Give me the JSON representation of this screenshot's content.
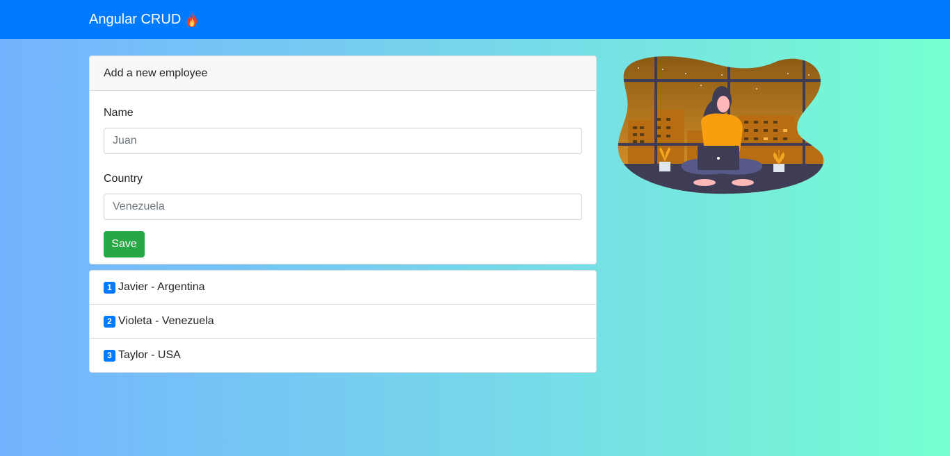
{
  "navbar": {
    "brand": "Angular CRUD",
    "brand_icon": "flame-icon",
    "bg_color": "#007bff"
  },
  "form": {
    "header": "Add a new employee",
    "name_label": "Name",
    "name_placeholder": "Juan",
    "country_label": "Country",
    "country_placeholder": "Venezuela",
    "save_label": "Save",
    "save_color": "#28a745"
  },
  "employees": [
    {
      "id": "1",
      "text": "Javier - Argentina"
    },
    {
      "id": "2",
      "text": "Violeta - Venezuela"
    },
    {
      "id": "3",
      "text": "Taylor - USA"
    }
  ],
  "illustration": {
    "icon": "woman-working-laptop-illustration"
  }
}
